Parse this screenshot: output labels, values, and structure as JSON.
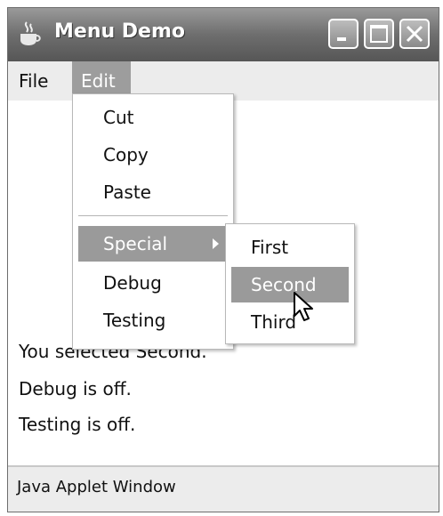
{
  "window": {
    "title": "Menu Demo",
    "title_icon": "java-cup-icon",
    "controls": [
      "minimize-icon",
      "maximize-icon",
      "close-icon"
    ]
  },
  "menubar": {
    "items": [
      {
        "label": "File",
        "active": false
      },
      {
        "label": "Edit",
        "active": true
      }
    ]
  },
  "edit_menu": {
    "items": [
      {
        "label": "Cut"
      },
      {
        "label": "Copy"
      },
      {
        "label": "Paste"
      },
      {
        "label": "Special",
        "submenu": true,
        "highlighted": true
      },
      {
        "label": "Debug"
      },
      {
        "label": "Testing"
      }
    ]
  },
  "special_submenu": {
    "items": [
      {
        "label": "First"
      },
      {
        "label": "Second",
        "highlighted": true
      },
      {
        "label": "Third"
      }
    ]
  },
  "messages": [
    "You selected Second.",
    "Debug is off.",
    "Testing is off."
  ],
  "status_bar": {
    "label": "Java Applet Window"
  },
  "colors": {
    "highlight": "#9a9a9a",
    "titlebar": "#6e6e6e",
    "menubar": "#ececec"
  }
}
